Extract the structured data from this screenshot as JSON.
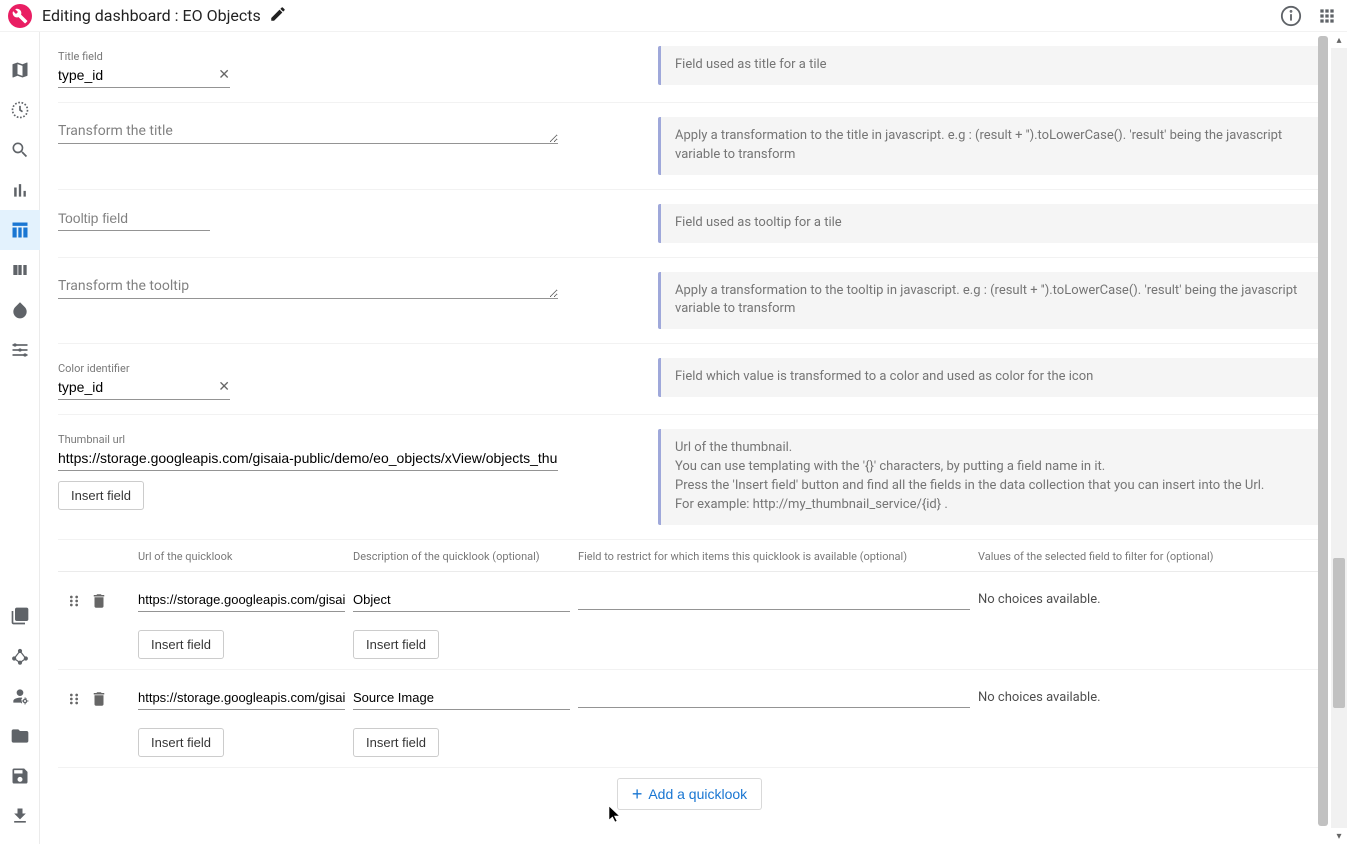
{
  "header": {
    "title_prefix": "Editing dashboard :",
    "title_name": "EO Objects"
  },
  "fields": {
    "title_field": {
      "label": "Title field",
      "value": "type_id",
      "hint": "Field used as title for a tile"
    },
    "transform_title": {
      "placeholder": "Transform the title",
      "value": "",
      "hint": "Apply a transformation to the title in javascript. e.g : (result + '').toLowerCase(). 'result' being the javascript variable to transform"
    },
    "tooltip_field": {
      "placeholder": "Tooltip field",
      "value": "",
      "hint": "Field used as tooltip for a tile"
    },
    "transform_tooltip": {
      "placeholder": "Transform the tooltip",
      "value": "",
      "hint": "Apply a transformation to the tooltip in javascript. e.g : (result + '').toLowerCase(). 'result' being the javascript variable to transform"
    },
    "color_identifier": {
      "label": "Color identifier",
      "value": "type_id",
      "hint": "Field which value is transformed to a color and used as color for the icon"
    },
    "thumbnail_url": {
      "label": "Thumbnail url",
      "value": "https://storage.googleapis.com/gisaia-public/demo/eo_objects/xView/objects_thumbnail",
      "hint_lines": [
        "Url of the thumbnail.",
        "You can use templating with the '{}' characters, by putting a field name in it.",
        "Press the 'Insert field' button and find all the fields in the data collection that you can insert into the Url.",
        "For example: http://my_thumbnail_service/{id} ."
      ]
    }
  },
  "buttons": {
    "insert_field": "Insert field",
    "add_quicklook": "Add a quicklook"
  },
  "quicklook": {
    "headers": {
      "url": "Url of the quicklook",
      "desc": "Description of the quicklook (optional)",
      "restrict": "Field to restrict for which items this quicklook is available (optional)",
      "values": "Values of the selected field to filter for (optional)"
    },
    "rows": [
      {
        "url": "https://storage.googleapis.com/gisaia-public",
        "desc": "Object",
        "values_text": "No choices available."
      },
      {
        "url": "https://storage.googleapis.com/gisaia-public",
        "desc": "Source Image",
        "values_text": "No choices available."
      }
    ]
  }
}
